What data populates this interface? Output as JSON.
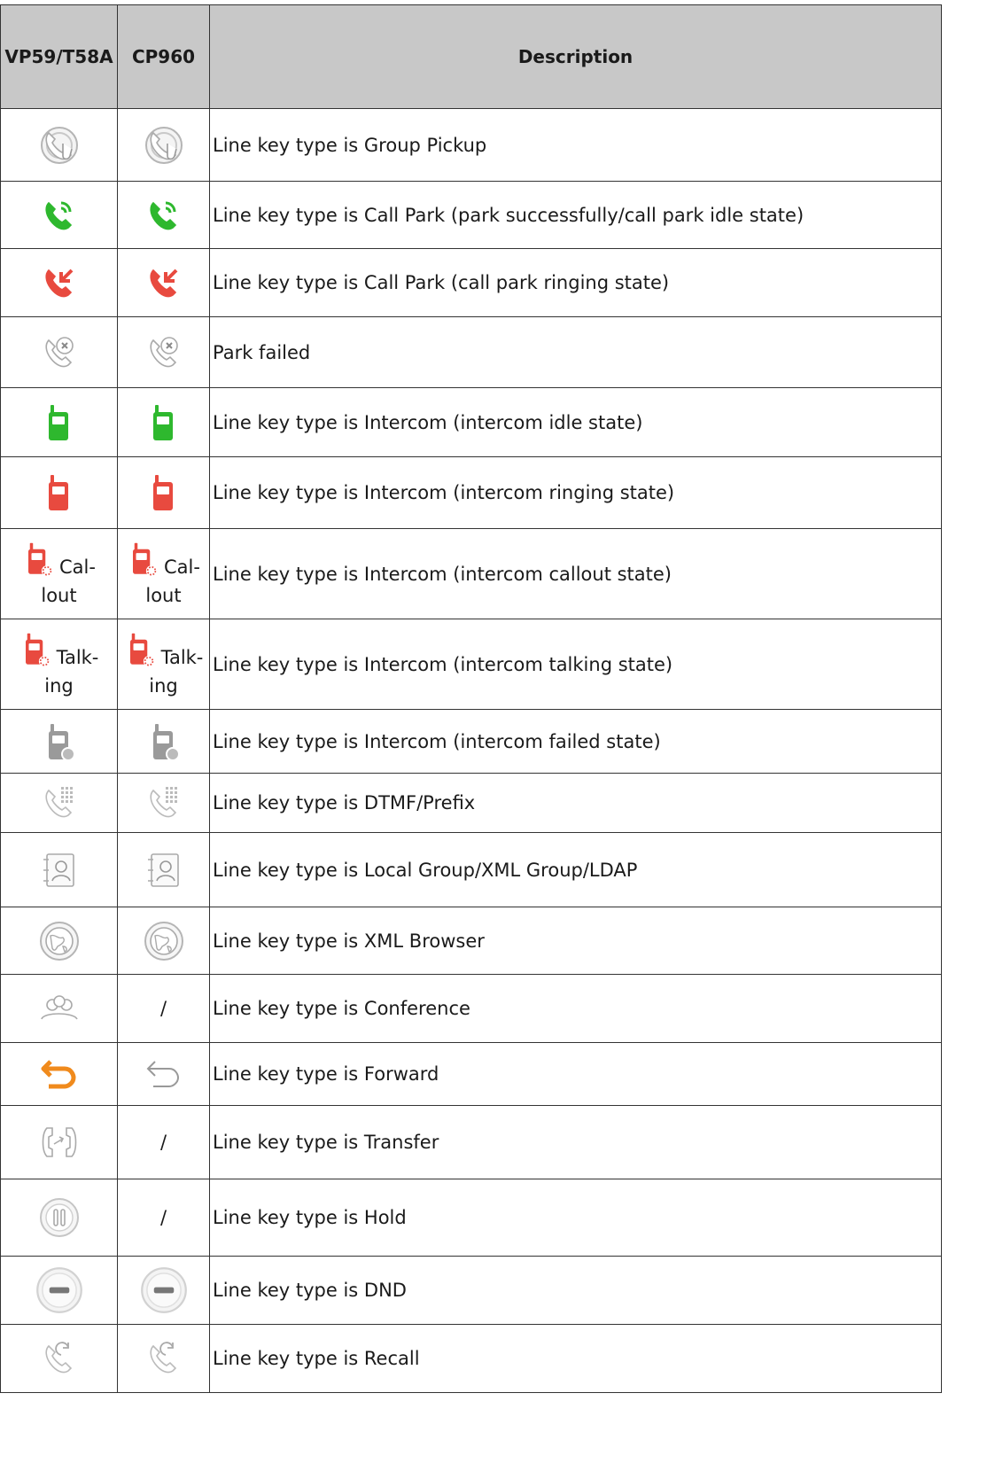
{
  "headers": [
    "VP59/T58A",
    "CP960",
    "Description"
  ],
  "rows": [
    {
      "t58_icon": "group-pickup-icon",
      "cp_icon": "group-pickup-icon",
      "desc": "Line key type is Group Pickup"
    },
    {
      "t58_icon": "call-park-green-icon",
      "cp_icon": "call-park-green-icon",
      "desc": "Line key type is Call Park (park successfully/call park idle state)"
    },
    {
      "t58_icon": "call-park-red-icon",
      "cp_icon": "call-park-red-icon",
      "desc": "Line key type is Call Park (call park ringing state)"
    },
    {
      "t58_icon": "park-failed-icon",
      "cp_icon": "park-failed-icon",
      "desc": "Park failed"
    },
    {
      "t58_icon": "intercom-green-icon",
      "cp_icon": "intercom-green-icon",
      "desc": "Line key type is Intercom (intercom idle state)"
    },
    {
      "t58_icon": "intercom-red-icon",
      "cp_icon": "intercom-red-icon",
      "desc": "Line key type is Intercom (intercom ringing state)"
    },
    {
      "t58_icon": "intercom-callout-icon",
      "t58_text": "Cal-",
      "t58_text2": "lout",
      "cp_icon": "intercom-callout-icon",
      "cp_text": "Cal-",
      "cp_text2": "lout",
      "desc": "Line key type is Intercom (intercom callout state)"
    },
    {
      "t58_icon": "intercom-talking-icon",
      "t58_text": "Talk-",
      "t58_text2": "ing",
      "cp_icon": "intercom-talking-icon",
      "cp_text": "Talk-",
      "cp_text2": "ing",
      "desc": "Line key type is Intercom (intercom talking state)"
    },
    {
      "t58_icon": "intercom-failed-icon",
      "cp_icon": "intercom-failed-icon",
      "desc": "Line key type is Intercom (intercom failed state)"
    },
    {
      "t58_icon": "dtmf-prefix-icon",
      "cp_icon": "dtmf-prefix-icon",
      "desc": "Line key type is DTMF/Prefix"
    },
    {
      "t58_icon": "group-contacts-icon",
      "cp_icon": "group-contacts-icon",
      "desc": "Line key type is Local Group/XML Group/LDAP"
    },
    {
      "t58_icon": "xml-browser-icon",
      "cp_icon": "xml-browser-icon",
      "desc": "Line key type is XML Browser"
    },
    {
      "t58_icon": "conference-icon",
      "cp_text": "/",
      "desc": "Line key type is Conference"
    },
    {
      "t58_icon": "forward-orange-icon",
      "cp_icon": "forward-grey-icon",
      "desc": "Line key type is Forward"
    },
    {
      "t58_icon": "transfer-icon",
      "cp_text": "/",
      "desc": "Line key type is Transfer"
    },
    {
      "t58_icon": "hold-icon",
      "cp_text": "/",
      "desc": "Line key type is Hold"
    },
    {
      "t58_icon": "dnd-icon",
      "cp_icon": "dnd-icon",
      "desc": "Line key type is DND"
    },
    {
      "t58_icon": "recall-icon",
      "cp_icon": "recall-icon",
      "desc": "Line key type is Recall"
    }
  ],
  "colors": {
    "header_bg": "#c8c8c8",
    "green": "#2eb82e",
    "red": "#e84a3f",
    "orange": "#f08a1c",
    "grey": "#9a9a9a"
  }
}
